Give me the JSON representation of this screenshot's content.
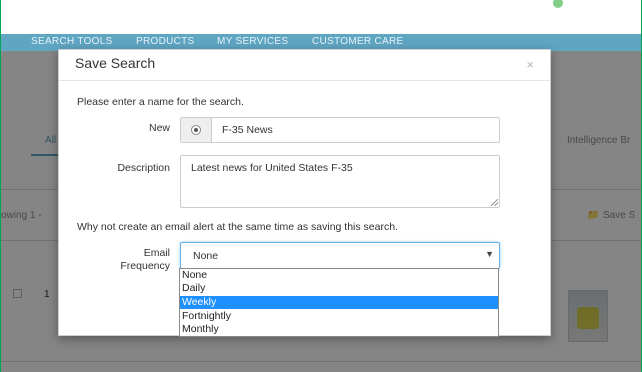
{
  "nav": {
    "items": [
      "SEARCH TOOLS",
      "PRODUCTS",
      "MY SERVICES",
      "CUSTOMER CARE"
    ]
  },
  "background": {
    "tab_fragment": "All",
    "right_tab": "Intelligence Br",
    "showing": "owing 1 -",
    "save_link": "Save S",
    "row_number": "1"
  },
  "modal": {
    "title": "Save Search",
    "close_glyph": "×",
    "prompt": "Please enter a name for the search.",
    "name_label": "New",
    "name_value": "F-35 News",
    "description_label": "Description",
    "description_value": "Latest news for United States F-35",
    "alert_prompt": "Why not create an email alert at the same time as saving this search.",
    "frequency_label_line1": "Email",
    "frequency_label_line2": "Frequency",
    "frequency_selected": "None",
    "frequency_arrow": "▼",
    "frequency_options": [
      "None",
      "Daily",
      "Weekly",
      "Fortnightly",
      "Monthly"
    ],
    "highlighted_option": "Weekly"
  },
  "colors": {
    "nav_bar": "#5fa6c3",
    "frame_border": "#00a651",
    "option_highlight": "#1e90ff"
  }
}
